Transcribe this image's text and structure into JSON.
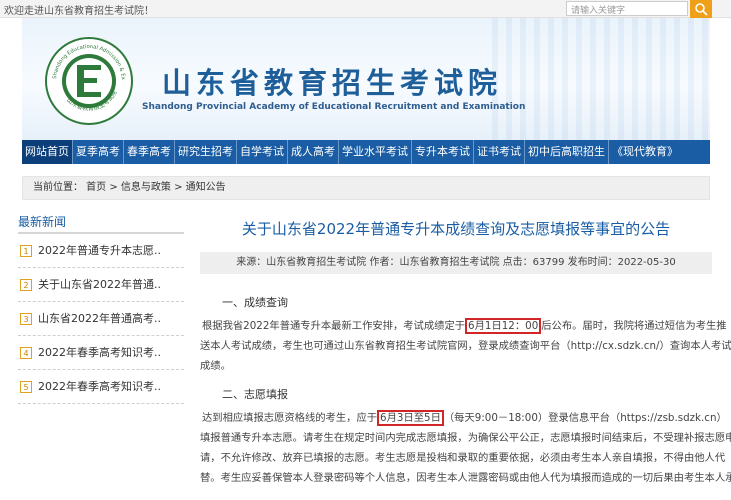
{
  "topbar": {
    "welcome": "欢迎走进山东省教育招生考试院！",
    "search_placeholder": "请输入关键字"
  },
  "banner": {
    "title": "山东省教育招生考试院",
    "subtitle": "Shandong Provincial Academy of Educational Recruitment and Examination",
    "logo_letter": "E",
    "logo_ring_top": "Shandong Educational Admission & Examination",
    "logo_ring_bottom": "山东省教育招生考试院"
  },
  "nav": [
    "网站首页",
    "夏季高考",
    "春季高考",
    "研究生招考",
    "自学考试",
    "成人高考",
    "学业水平考试",
    "专升本考试",
    "证书考试",
    "初中后高职招生",
    "《现代教育》"
  ],
  "breadcrumb": "当前位置： 首页 > 信息与政策 > 通知公告",
  "sidebar": {
    "title": "最新新闻",
    "items": [
      {
        "num": "1",
        "label": "2022年普通专升本志愿.."
      },
      {
        "num": "2",
        "label": "关于山东省2022年普通.."
      },
      {
        "num": "3",
        "label": "山东省2022年普通高考.."
      },
      {
        "num": "4",
        "label": "2022年春季高考知识考.."
      },
      {
        "num": "5",
        "label": "2022年春季高考知识考.."
      }
    ]
  },
  "article": {
    "title": "关于山东省2022年普通专升本成绩查询及志愿填报等事宜的公告",
    "meta": "来源：山东省教育招生考试院 作者：山东省教育招生考试院 点击：63799 发布时间：2022-05-30",
    "section1": "一、成绩查询",
    "p1_before": "根据我省2022年普通专升本最新工作安排，考试成绩定于",
    "p1_highlight": "6月1日12：00",
    "p1_after": "后公布。届时，我院将通过短信为考生推",
    "p1_line2": "送本人考试成绩，考生也可通过山东省教育招生考试院官网，登录成绩查询平台（http://cx.sdzk.cn/）查询本人考试",
    "p1_line3": "成绩。",
    "section2": "二、志愿填报",
    "p2_before": "达到相应填报志愿资格线的考生，应于",
    "p2_highlight": "6月3日至5日",
    "p2_after": "（每天9:00－18:00）登录信息平台（https://zsb.sdzk.cn）",
    "p2_line2": "填报普通专升本志愿。请考生在规定时间内完成志愿填报，为确保公平公正，志愿填报时间结束后，不受理补报志愿申",
    "p2_line3": "请，不允许修改、放弃已填报的志愿。考生志愿是投档和录取的重要依据，必须由考生本人亲自填报，不得由他人代",
    "p2_line4": "替。考生应妥善保管本人登录密码等个人信息，因考生本人泄露密码或由他人代为填报而造成的一切后果由考生本人承"
  },
  "colors": {
    "brand_blue": "#1a5da4",
    "highlight_red": "#d22626",
    "search_orange": "#f0a018"
  }
}
